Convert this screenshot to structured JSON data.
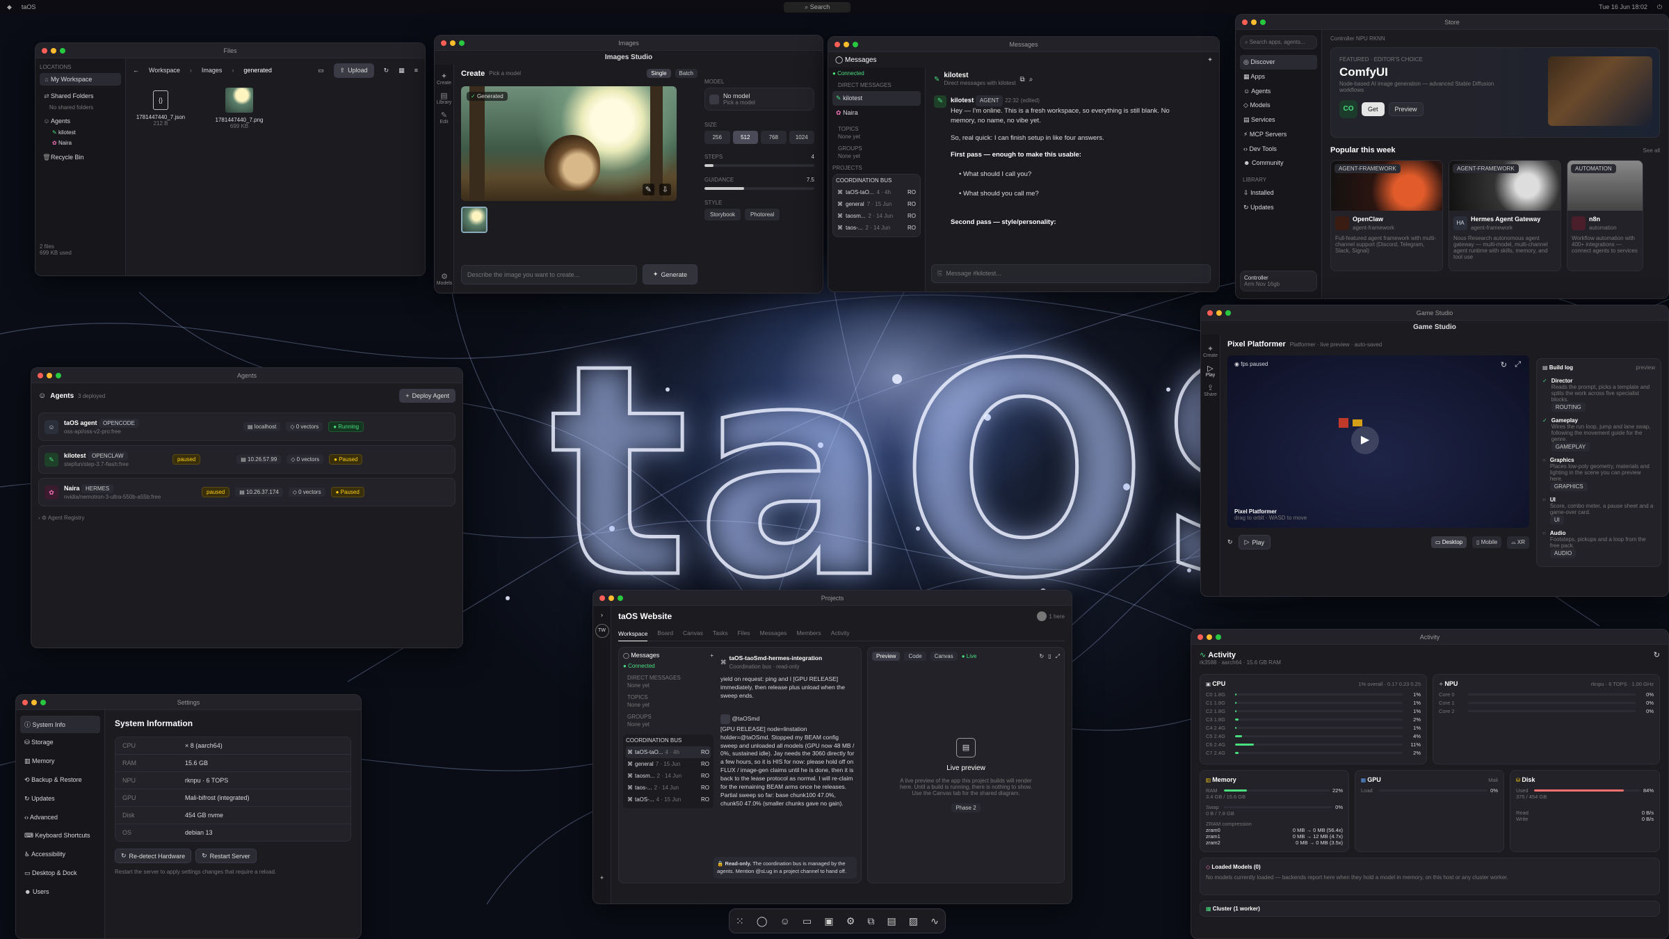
{
  "menubar": {
    "app": "taOS",
    "search": "Search",
    "date": "Tue 16 Jun 18:02"
  },
  "files": {
    "title": "Files",
    "locations_h": "LOCATIONS",
    "my_workspace": "My Workspace",
    "shared": "Shared Folders",
    "no_shared": "No shared folders",
    "agents_h": "Agents",
    "agents": [
      "kilotest",
      "Naira"
    ],
    "recycle": "Recycle Bin",
    "crumbs": [
      "Workspace",
      "Images",
      "generated"
    ],
    "upload": "Upload",
    "items": [
      {
        "name": "1781447440_7.json",
        "size": "212 B"
      },
      {
        "name": "1781447440_7.png",
        "size": "699 KB"
      }
    ],
    "count": "2 files",
    "used": "699 KB used"
  },
  "images": {
    "title": "Images",
    "studio": "Images Studio",
    "create": "Create",
    "pick": "Pick a model",
    "single": "Single",
    "batch": "Batch",
    "generated": "Generated",
    "side": [
      "Create",
      "Library",
      "Edit"
    ],
    "model_h": "MODEL",
    "no_model": "No model",
    "pick_model": "Pick a model",
    "size_h": "SIZE",
    "sizes": [
      "256",
      "512",
      "768",
      "1024"
    ],
    "steps_h": "STEPS",
    "steps": "4",
    "guidance_h": "GUIDANCE",
    "guidance": "7.5",
    "style_h": "STYLE",
    "styles": [
      "Storybook",
      "Photoreal"
    ],
    "prompt": "Describe the image you want to create...",
    "generate": "Generate",
    "models": "Models"
  },
  "messages": {
    "title": "Messages",
    "head": "Messages",
    "connected": "Connected",
    "dm_h": "DIRECT MESSAGES",
    "dms": [
      "kilotest",
      "Naira"
    ],
    "topics_h": "TOPICS",
    "none": "None yet",
    "groups_h": "GROUPS",
    "projects_h": "PROJECTS",
    "bus_h": "COORDINATION BUS",
    "channels": [
      {
        "n": "taOS-taO...",
        "t": "4 · 4h"
      },
      {
        "n": "general",
        "t": "7 · 15 Jun"
      },
      {
        "n": "taosm...",
        "t": "2 · 14 Jun"
      },
      {
        "n": "taos-...",
        "t": "2 · 14 Jun"
      }
    ],
    "ro": "RO",
    "chat_name": "kilotest",
    "chat_sub": "Direct messages with kilotest",
    "sender": "kilotest",
    "agent_badge": "AGENT",
    "time": "22:32",
    "edited": "(edited)",
    "lines": [
      "Hey — I'm online. This is a fresh workspace, so everything is still blank. No memory, no name, no vibe yet.",
      "So, real quick: I can finish setup in like four answers.",
      "First pass — enough to make this usable:",
      "What should I call you?",
      "What should you call me?",
      "Second pass — style/personality:"
    ],
    "placeholder": "Message #kilotest..."
  },
  "store": {
    "title": "Store",
    "search": "Search apps, agents...",
    "controller": "Controller",
    "npu": "NPU RKNN",
    "nav": [
      "Discover",
      "Apps",
      "Agents",
      "Models",
      "Services",
      "MCP Servers",
      "Dev Tools",
      "Community"
    ],
    "library_h": "LIBRARY",
    "library": [
      "Installed",
      "Updates"
    ],
    "ctrl_name": "Controller",
    "ctrl_sub": "Arm Nov 16gb",
    "featured_tag": "FEATURED · EDITOR'S CHOICE",
    "featured_name": "ComfyUI",
    "featured_desc": "Node-based AI image generation — advanced Stable Diffusion workflows",
    "co": "CO",
    "get": "Get",
    "preview": "Preview",
    "popular_h": "Popular this week",
    "see_all": "See all",
    "apps": [
      {
        "tag": "AGENT-FRAMEWORK",
        "name": "OpenClaw",
        "sub": "agent-framework",
        "desc": "Full-featured agent framework with multi-channel support (Discord, Telegram, Slack, Signal)"
      },
      {
        "tag": "AGENT-FRAMEWORK",
        "name": "Hermes Agent Gateway",
        "sub": "agent-framework",
        "desc": "Nous Research autonomous agent gateway — multi-model, multi-channel agent runtime with skills, memory, and tool use"
      },
      {
        "tag": "AUTOMATION",
        "name": "n8n",
        "sub": "automation",
        "desc": "Workflow automation with 400+ integrations — connect agents to services"
      }
    ]
  },
  "game": {
    "title": "Game Studio",
    "head": "Game Studio",
    "side": [
      "Create",
      "Play",
      "Share"
    ],
    "name": "Pixel Platformer",
    "meta": "Platformer · live preview · auto-saved",
    "fps": "fps",
    "paused": "paused",
    "overlay_title": "Pixel Platformer",
    "overlay_sub": "drag to orbit · WASD to move",
    "play": "Play",
    "desktop": "Desktop",
    "mobile": "Mobile",
    "xr": "XR",
    "log_h": "Build log",
    "log_preview": "preview",
    "steps": [
      {
        "t": "Director",
        "d": "Reads the prompt, picks a template and splits the work across five specialist blocks.",
        "tag": "ROUTING"
      },
      {
        "t": "Gameplay",
        "d": "Wires the run loop, jump and lane swap, following the movement guide for the genre.",
        "tag": "GAMEPLAY"
      },
      {
        "t": "Graphics",
        "d": "Places low-poly geometry, materials and lighting in the scene you can preview here.",
        "tag": "GRAPHICS"
      },
      {
        "t": "UI",
        "d": "Score, combo meter, a pause sheet and a game-over card.",
        "tag": "UI"
      },
      {
        "t": "Audio",
        "d": "Footsteps, pickups and a loop from the free pack.",
        "tag": "AUDIO"
      }
    ]
  },
  "agents": {
    "title": "Agents",
    "head": "Agents",
    "deployed": "3 deployed",
    "deploy": "Deploy Agent",
    "list": [
      {
        "name": "taOS agent",
        "kind": "OPENCODE",
        "model": "oss-api/oss-v2-pro:free",
        "host": "localhost",
        "vec": "0 vectors",
        "status": "Running",
        "paused": ""
      },
      {
        "name": "kilotest",
        "kind": "OPENCLAW",
        "model": "stepfun/step-3.7-flash:free",
        "host": "10.26.57.99",
        "vec": "0 vectors",
        "status": "Paused",
        "paused": "paused"
      },
      {
        "name": "Naira",
        "kind": "HERMES",
        "model": "nvidia/nemotron-3-ultra-550b-a55b:free",
        "host": "10.26.37.174",
        "vec": "0 vectors",
        "status": "Paused",
        "paused": "paused"
      }
    ],
    "registry": "Agent Registry"
  },
  "projects": {
    "title": "Projects",
    "tw": "TW",
    "name": "taOS Website",
    "here": "1 here",
    "tabs": [
      "Workspace",
      "Board",
      "Canvas",
      "Tasks",
      "Files",
      "Messages",
      "Members",
      "Activity"
    ],
    "msgs": "Messages",
    "connected": "Connected",
    "dm_h": "DIRECT MESSAGES",
    "topics_h": "TOPICS",
    "groups_h": "GROUPS",
    "none": "None yet",
    "bus_h": "COORDINATION BUS",
    "channels": [
      {
        "n": "taOS-taO...",
        "t": "4 · 4h"
      },
      {
        "n": "general",
        "t": "7 · 15 Jun"
      },
      {
        "n": "taosm...",
        "t": "2 · 14 Jun"
      },
      {
        "n": "taos-...",
        "t": "2 · 14 Jun"
      },
      {
        "n": "taOS-...",
        "t": "4 · 15 Jun"
      }
    ],
    "ro": "RO",
    "thread": "taOS-taoSmd-hermes-integration",
    "thread_sub": "Coordination bus · read-only",
    "msg_top": "yield on request: ping and I [GPU RELEASE] immediately, then release plus unload when the sweep ends.",
    "author": "@taOSmd",
    "msg": "[GPU RELEASE] node=linstation holder=@taOSmd. Stopped my BEAM config sweep and unloaded all models (GPU now 48 MB / 0%, sustained idle). Jay needs the 3060 directly for a few hours, so it is HIS for now: please hold off on FLUX / image-gen claims until he is done, then it is back to the lease protocol as normal. I will re-claim for the remaining BEAM arms once he releases. Partial sweep so far: base chunk100 47.0%, chunk50 47.0% (smaller chunks gave no gain).",
    "ro_note": "The coordination bus is managed by the agents. Mention @sLug in a project channel to hand off.",
    "ro_label": "Read-only.",
    "pv_tabs": [
      "Preview",
      "Code",
      "Canvas"
    ],
    "live": "Live",
    "lp_title": "Live preview",
    "lp_desc": "A live preview of the app this project builds will render here. Until a build is running, there is nothing to show. Use the Canvas tab for the shared diagram.",
    "phase": "Phase 2"
  },
  "settings": {
    "title": "Settings",
    "nav": [
      "System Info",
      "Storage",
      "Memory",
      "Backup & Restore",
      "Updates",
      "Advanced",
      "Keyboard Shortcuts",
      "Accessibility",
      "Desktop & Dock",
      "Users"
    ],
    "head": "System Information",
    "rows": [
      [
        "CPU",
        "× 8 (aarch64)"
      ],
      [
        "RAM",
        "15.6 GB"
      ],
      [
        "NPU",
        "rknpu · 6 TOPS"
      ],
      [
        "GPU",
        "Mali-bifrost (integrated)"
      ],
      [
        "Disk",
        "454 GB nvme"
      ],
      [
        "OS",
        "debian 13"
      ]
    ],
    "redetect": "Re-detect Hardware",
    "restart": "Restart Server",
    "note": "Restart the server to apply settings changes that require a reload."
  },
  "activity": {
    "title": "Activity",
    "head": "Activity",
    "sub": "rk3588 · aarch64 · 15.6 GB RAM",
    "cpu": "CPU",
    "cpu_meta": "1% overall · 0.17 0.23 0.25",
    "cores": [
      [
        "C0 1.8G",
        1
      ],
      [
        "C1 1.8G",
        1
      ],
      [
        "C2 1.8G",
        1
      ],
      [
        "C3 1.8G",
        2
      ],
      [
        "C4 2.4G",
        1
      ],
      [
        "C5 2.4G",
        4
      ],
      [
        "C6 2.4G",
        11
      ],
      [
        "C7 2.4G",
        2
      ]
    ],
    "npu": "NPU",
    "npu_meta": "rknpu · 6 TOPS · 1.00 GHz",
    "npu_cores": [
      [
        "Core 0",
        0
      ],
      [
        "Core 1",
        0
      ],
      [
        "Core 2",
        0
      ]
    ],
    "memory": "Memory",
    "ram_pct": 22,
    "ram_lbl": "RAM",
    "ram_val": "3.4 GB / 15.6 GB",
    "swap": "Swap",
    "swap_val": "0 B / 7.8 GB",
    "swap_pct": 0,
    "zram_h": "ZRAM compression",
    "zram": [
      [
        "zram0",
        "0 MB → 0 MB (56.4x)"
      ],
      [
        "zram1",
        "0 MB → 12 MB (4.7x)"
      ],
      [
        "zram2",
        "0 MB → 0 MB (3.5x)"
      ]
    ],
    "gpu": "GPU",
    "gpu_meta": "Mali",
    "gpu_load": "Load",
    "gpu_pct": 0,
    "disk": "Disk",
    "disk_used": "Used",
    "disk_pct": 84,
    "disk_val": "375 / 454 GB",
    "read": "Read",
    "read_v": "0 B/s",
    "write": "Write",
    "write_v": "0 B/s",
    "loaded": "Loaded Models (0)",
    "loaded_note": "No models currently loaded — backends report here when they hold a model in memory, on this host or any cluster worker.",
    "cluster": "Cluster (1 worker)"
  }
}
